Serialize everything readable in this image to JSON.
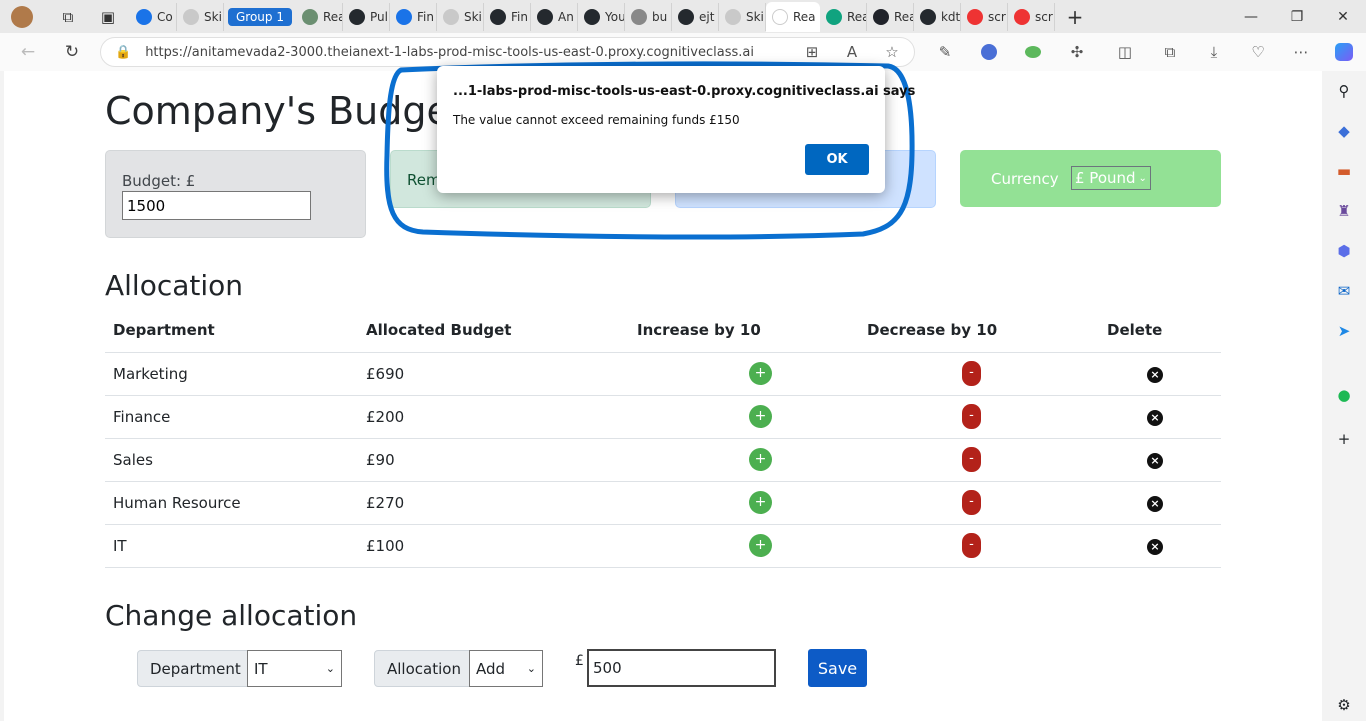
{
  "browser": {
    "tabs": [
      {
        "label": "Co",
        "color": "#1a73e8"
      },
      {
        "label": "Ski",
        "color": "#c9c9c9"
      },
      {
        "label": "Rea",
        "color": "#6b8f71"
      },
      {
        "label": "Pul",
        "color": "#24292e"
      },
      {
        "label": "Fin",
        "color": "#1a73e8"
      },
      {
        "label": "Ski",
        "color": "#c9c9c9"
      },
      {
        "label": "Fin",
        "color": "#24292e"
      },
      {
        "label": "An",
        "color": "#24292e"
      },
      {
        "label": "You",
        "color": "#24292e"
      },
      {
        "label": "bu",
        "color": "#888888"
      },
      {
        "label": "ejt",
        "color": "#24292e"
      },
      {
        "label": "Ski",
        "color": "#c9c9c9"
      },
      {
        "label": "Rea",
        "color": "#fff"
      },
      {
        "label": "Rea",
        "color": "#10a37f"
      },
      {
        "label": "Rea",
        "color": "#20232a"
      },
      {
        "label": "kdt",
        "color": "#24292e"
      },
      {
        "label": "scr",
        "color": "#e33"
      },
      {
        "label": "scr",
        "color": "#e33"
      }
    ],
    "group_label": "Group 1",
    "url": "https://anitamevada2-3000.theianext-1-labs-prod-misc-tools-us-east-0.proxy.cognitiveclass.ai"
  },
  "page": {
    "title": "Company's Budget",
    "budget_label": "Budget: £",
    "budget_value": "1500",
    "remaining_label": "Rem",
    "currency_label": "Currency",
    "currency_value": "£ Pound"
  },
  "allocation": {
    "heading": "Allocation",
    "columns": [
      "Department",
      "Allocated Budget",
      "Increase by 10",
      "Decrease by 10",
      "Delete"
    ],
    "rows": [
      {
        "department": "Marketing",
        "budget": "£690"
      },
      {
        "department": "Finance",
        "budget": "£200"
      },
      {
        "department": "Sales",
        "budget": "£90"
      },
      {
        "department": "Human Resource",
        "budget": "£270"
      },
      {
        "department": "IT",
        "budget": "£100"
      }
    ],
    "plus_symbol": "+",
    "minus_symbol": "-"
  },
  "change": {
    "heading": "Change allocation",
    "department_label": "Department",
    "department_value": "IT",
    "allocation_label": "Allocation",
    "allocation_value": "Add",
    "currency_symbol": "£",
    "amount": "500",
    "save_label": "Save"
  },
  "dialog": {
    "title": "...1-labs-prod-misc-tools-us-east-0.proxy.cognitiveclass.ai says",
    "message": "The value cannot exceed remaining funds  £150",
    "ok_label": "OK"
  }
}
